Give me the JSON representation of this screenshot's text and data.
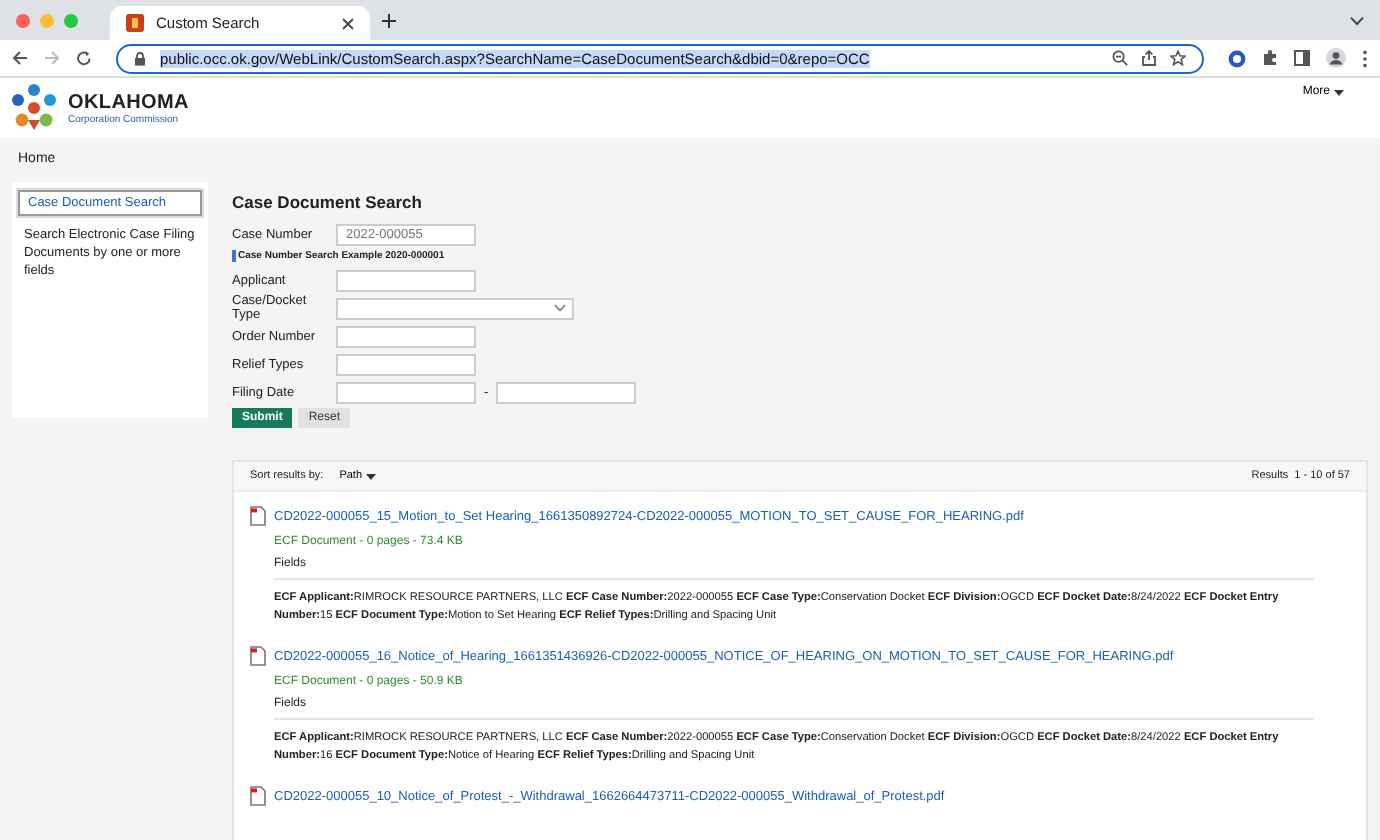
{
  "browser": {
    "tab_title": "Custom Search",
    "url": "public.occ.ok.gov/WebLink/CustomSearch.aspx?SearchName=CaseDocumentSearch&dbid=0&repo=OCC"
  },
  "header": {
    "logo_title": "OKLAHOMA",
    "logo_subtitle": "Corporation Commission",
    "more": "More"
  },
  "nav": {
    "home": "Home"
  },
  "sidebar": {
    "items": [
      {
        "label": "Case Document Search",
        "selected": true
      }
    ],
    "description": "Search Electronic Case Filing Documents by one or more fields"
  },
  "form": {
    "title": "Case Document Search",
    "hint": "Case Number Search Example 2020-000001",
    "fields": [
      {
        "label": "Case Number",
        "kind": "text",
        "value": "2022-000055"
      },
      {
        "label": "Applicant",
        "kind": "text"
      },
      {
        "label": "Case/Docket Type",
        "kind": "select"
      },
      {
        "label": "Order Number",
        "kind": "text"
      },
      {
        "label": "Relief Types",
        "kind": "text"
      },
      {
        "label": "Filing Date",
        "kind": "range",
        "separator": "-"
      }
    ],
    "buttons": [
      {
        "label": "Submit",
        "kind": "primary"
      },
      {
        "label": "Reset",
        "kind": "secondary"
      }
    ]
  },
  "results": {
    "sort_label": "Sort results by:",
    "sort_value": "Path",
    "summary": "Results  1 - 10 of 57",
    "items": [
      {
        "title": "CD2022-000055_15_Motion_to_Set Hearing_1661350892724-CD2022-000055_MOTION_TO_SET_CAUSE_FOR_HEARING.pdf",
        "meta": "ECF Document - 0 pages - 73.4 KB",
        "fields_label": "Fields",
        "details": "**ECF Applicant:**RIMROCK RESOURCE PARTNERS, LLC **ECF Case Number:**2022-000055 **ECF Case Type:**Conservation Docket **ECF Division:**OGCD **ECF Docket Date:**8/24/2022 **ECF Docket Entry Number:**15 **ECF Document Type:**Motion to Set Hearing **ECF Relief Types:**Drilling and Spacing Unit"
      },
      {
        "title": "CD2022-000055_16_Notice_of_Hearing_1661351436926-CD2022-000055_NOTICE_OF_HEARING_ON_MOTION_TO_SET_CAUSE_FOR_HEARING.pdf",
        "meta": "ECF Document - 0 pages - 50.9 KB",
        "fields_label": "Fields",
        "details": "**ECF Applicant:**RIMROCK RESOURCE PARTNERS, LLC **ECF Case Number:**2022-000055 **ECF Case Type:**Conservation Docket **ECF Division:**OGCD **ECF Docket Date:**8/24/2022 **ECF Docket Entry Number:**16 **ECF Document Type:**Notice of Hearing **ECF Relief Types:**Drilling and Spacing Unit"
      },
      {
        "title": "CD2022-000055_10_Notice_of_Protest_-_Withdrawal_1662664473711-CD2022-000055_Withdrawal_of_Protest.pdf"
      }
    ]
  }
}
